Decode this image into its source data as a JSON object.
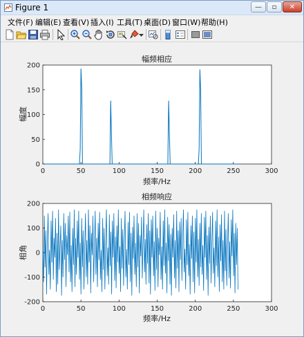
{
  "window": {
    "title": "Figure 1"
  },
  "controls": {
    "minimize": "—",
    "restore": "▫",
    "close": "✕"
  },
  "menu": [
    "文件(F)",
    "编辑(E)",
    "查看(V)",
    "插入(I)",
    "工具(T)",
    "桌面(D)",
    "窗口(W)",
    "帮助(H)"
  ],
  "toolbar_icons": [
    "new-figure-icon",
    "open-file-icon",
    "save-icon",
    "print-icon",
    "arrow-pointer-icon",
    "zoom-in-icon",
    "zoom-out-icon",
    "pan-hand-icon",
    "rotate-3d-icon",
    "data-cursor-icon",
    "brush-icon",
    "dropdown-arrow-icon",
    "link-plot-icon",
    "insert-colorbar-icon",
    "insert-legend-icon",
    "hide-plot-tools-icon",
    "show-plot-tools-icon"
  ],
  "colors": {
    "line": "#0072bd",
    "axes_bg": "#ffffff",
    "figure_bg": "#f0f0f0"
  },
  "chart_data": [
    {
      "type": "line",
      "title": "幅频相应",
      "xlabel": "频率/Hz",
      "ylabel": "幅度",
      "xlim": [
        0,
        300
      ],
      "ylim": [
        0,
        200
      ],
      "xticks": [
        0,
        50,
        100,
        150,
        200,
        250,
        300
      ],
      "yticks": [
        0,
        50,
        100,
        150,
        200
      ],
      "series": [
        {
          "x": [
            0,
            48,
            49,
            50,
            51,
            52,
            88,
            89,
            90,
            91,
            92,
            164,
            165,
            166,
            167,
            168,
            204,
            205,
            206,
            207,
            208,
            256
          ],
          "y": [
            0,
            0,
            30,
            193,
            152,
            0,
            0,
            128,
            60,
            0,
            0,
            0,
            128,
            60,
            0,
            0,
            0,
            30,
            191,
            150,
            0,
            0
          ]
        }
      ]
    },
    {
      "type": "line",
      "title": "相频响应",
      "xlabel": "频率/Hz",
      "ylabel": "相角",
      "xlim": [
        0,
        300
      ],
      "ylim": [
        -200,
        200
      ],
      "xticks": [
        0,
        50,
        100,
        150,
        200,
        250,
        300
      ],
      "yticks": [
        -200,
        -100,
        0,
        100,
        200
      ],
      "series": [
        {
          "x_range": [
            0,
            256
          ],
          "y": [
            20,
            -120,
            150,
            -60,
            90,
            -170,
            40,
            160,
            -90,
            10,
            -150,
            130,
            -40,
            170,
            -110,
            60,
            -20,
            140,
            -160,
            80,
            -130,
            175,
            -70,
            20,
            110,
            -175,
            50,
            -100,
            160,
            -30,
            120,
            -140,
            70,
            -10,
            150,
            -80,
            165,
            -120,
            30,
            -160,
            100,
            -50,
            175,
            -140,
            60,
            -90,
            130,
            -20,
            170,
            -110,
            40,
            -170,
            140,
            -60,
            90,
            -150,
            20,
            160,
            -100,
            50,
            -130,
            175,
            -40,
            110,
            -165,
            80,
            -10,
            150,
            -120,
            30,
            170,
            -90,
            60,
            -140,
            120,
            -30,
            165,
            -110,
            10,
            -160,
            140,
            -70,
            100,
            -150,
            45,
            175,
            -95,
            20,
            -130,
            155,
            -55,
            85,
            -170,
            130,
            -20,
            160,
            -115,
            65,
            -145,
            110,
            -40,
            175,
            -85,
            25,
            -160,
            140,
            -65,
            95,
            -135,
            55,
            170,
            -100,
            15,
            -150,
            125,
            -50,
            165,
            -120,
            80,
            -175,
            105,
            -25,
            150,
            -90,
            40,
            -140,
            160,
            -60,
            120,
            -165,
            70,
            -15,
            145,
            -105,
            35,
            175,
            -80,
            55,
            -130,
            115,
            -45,
            160,
            -125,
            90,
            -170,
            135,
            -20,
            150,
            -95,
            45,
            -155,
            170,
            -70,
            100,
            -140,
            60,
            -10,
            165,
            -110,
            25,
            -150,
            130,
            -55,
            175,
            -85,
            40,
            -165,
            145,
            -35,
            115,
            -130,
            75,
            -175,
            100,
            -20,
            155,
            -105,
            50,
            -145,
            170,
            -65,
            90,
            -160,
            125,
            -30,
            140,
            -115,
            60,
            175,
            -80,
            15,
            -150,
            135,
            -50,
            165,
            -95,
            35,
            -170,
            110,
            -25,
            150,
            -120,
            85,
            -165,
            140,
            -40,
            175,
            -100,
            55,
            -135,
            120,
            -60,
            160,
            -90,
            30,
            -155,
            145,
            -20,
            170,
            -110,
            70,
            -175,
            105,
            -45,
            150,
            -125,
            40,
            165,
            -85,
            20,
            -140,
            130,
            -55,
            175,
            -100,
            65,
            -160,
            115,
            -35,
            155,
            -120,
            50,
            -150,
            170,
            -75,
            95,
            -135,
            25,
            160,
            -105,
            45,
            -145,
            135,
            -15,
            175,
            -95,
            80,
            -165,
            120,
            -50,
            100,
            -150
          ]
        }
      ]
    }
  ]
}
